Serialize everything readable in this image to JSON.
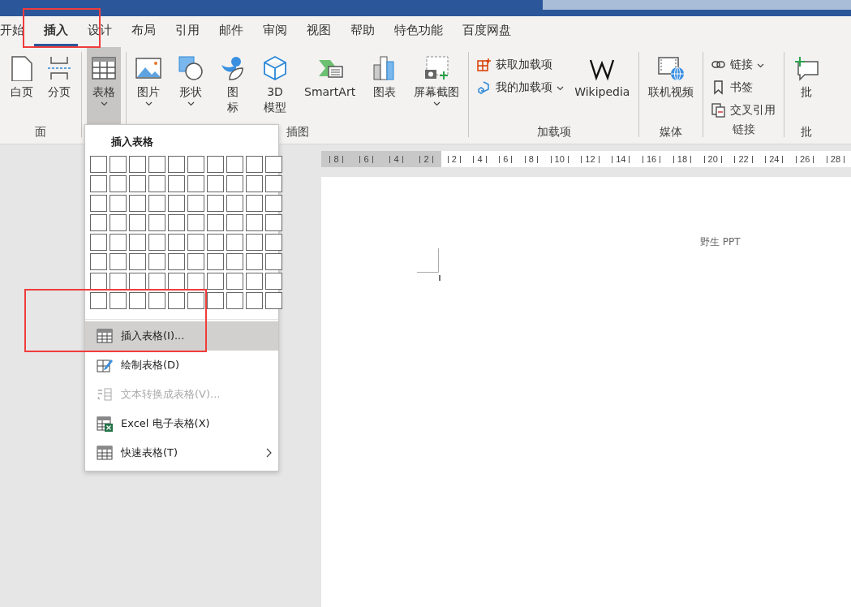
{
  "tabs": [
    {
      "label": "开始",
      "selected": false
    },
    {
      "label": "插入",
      "selected": true
    },
    {
      "label": "设计",
      "selected": false
    },
    {
      "label": "布局",
      "selected": false
    },
    {
      "label": "引用",
      "selected": false
    },
    {
      "label": "邮件",
      "selected": false
    },
    {
      "label": "审阅",
      "selected": false
    },
    {
      "label": "视图",
      "selected": false
    },
    {
      "label": "帮助",
      "selected": false
    },
    {
      "label": "特色功能",
      "selected": false
    },
    {
      "label": "百度网盘",
      "selected": false
    }
  ],
  "ribbon": {
    "groups": [
      {
        "label": "面",
        "items": [
          {
            "kind": "large",
            "label": "白页",
            "dropdown": false,
            "selected": false
          },
          {
            "kind": "large",
            "label": "分页",
            "dropdown": false,
            "selected": false
          }
        ]
      },
      {
        "items": [
          {
            "kind": "large",
            "label": "表格",
            "dropdown": true,
            "selected": true
          }
        ]
      },
      {
        "label": "插图",
        "items": [
          {
            "kind": "large",
            "label": "图片",
            "dropdown": true,
            "selected": false
          },
          {
            "kind": "large",
            "label": "形状",
            "dropdown": true,
            "selected": false
          },
          {
            "kind": "stacked",
            "label": "图标",
            "dropdown": false,
            "selected": false
          },
          {
            "kind": "wrapped",
            "label": "3D模型",
            "dropdown": false,
            "selected": false
          },
          {
            "kind": "large",
            "label": "SmartArt",
            "dropdown": false,
            "selected": false
          },
          {
            "kind": "large",
            "label": "图表",
            "dropdown": false,
            "selected": false
          },
          {
            "kind": "large",
            "label": "屏幕截图",
            "dropdown": true,
            "selected": false
          }
        ]
      },
      {
        "label": "加载项",
        "items": [
          {
            "kind": "small",
            "label": "获取加载项",
            "dropdown": false,
            "selected": false
          },
          {
            "kind": "small",
            "label": "我的加载项",
            "dropdown": true,
            "selected": false
          },
          {
            "kind": "large",
            "label": "Wikipedia",
            "dropdown": false,
            "selected": false
          }
        ]
      },
      {
        "label": "媒体",
        "items": [
          {
            "kind": "large",
            "label": "联机视频",
            "dropdown": false,
            "selected": false
          }
        ]
      },
      {
        "label": "链接",
        "items": [
          {
            "kind": "small",
            "label": "链接",
            "dropdown": true,
            "selected": false
          },
          {
            "kind": "small",
            "label": "书签",
            "dropdown": false,
            "selected": false
          },
          {
            "kind": "small",
            "label": "交叉引用",
            "dropdown": false,
            "selected": false
          }
        ]
      },
      {
        "label": "批",
        "items": [
          {
            "kind": "large",
            "label": "批",
            "dropdown": false,
            "selected": false
          }
        ]
      }
    ]
  },
  "ruler": {
    "left_ticks": [
      "8",
      "6",
      "4",
      "2"
    ],
    "right_ticks": [
      "2",
      "4",
      "6",
      "8",
      "10",
      "12",
      "14",
      "16",
      "18",
      "20",
      "22",
      "24",
      "26",
      "28"
    ]
  },
  "document": {
    "header_text": "野生 PPT"
  },
  "table_menu": {
    "title": "插入表格",
    "items": [
      {
        "label": "插入表格(I)...",
        "selected": true,
        "disabled": false,
        "submenu": false
      },
      {
        "label": "绘制表格(D)",
        "selected": false,
        "disabled": false,
        "submenu": false
      },
      {
        "label": "文本转换成表格(V)...",
        "selected": false,
        "disabled": true,
        "submenu": false
      },
      {
        "label": "Excel 电子表格(X)",
        "selected": false,
        "disabled": false,
        "submenu": false
      },
      {
        "label": "快速表格(T)",
        "selected": false,
        "disabled": false,
        "submenu": true
      }
    ]
  }
}
